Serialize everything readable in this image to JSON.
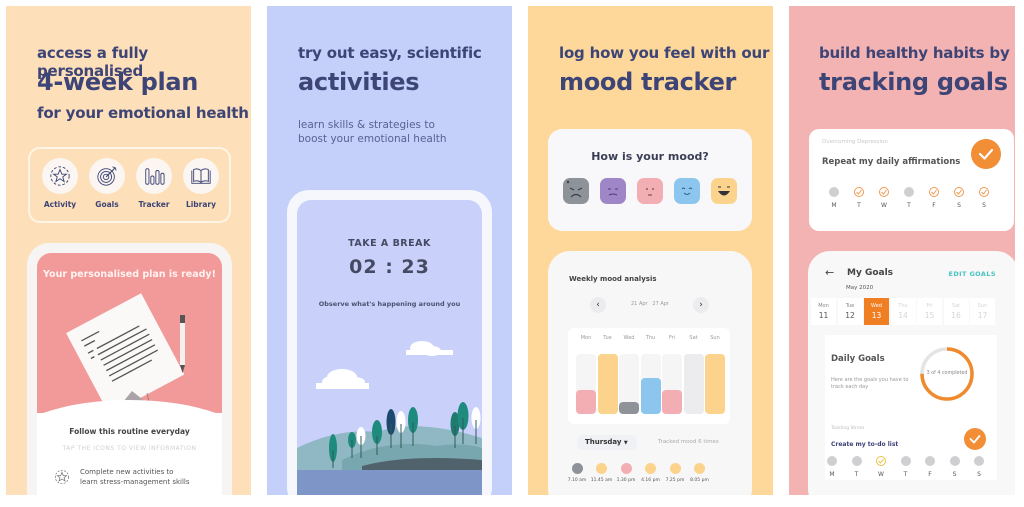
{
  "panels": [
    {
      "id": "plan",
      "background": "#fddfb9",
      "headline_small": "access a fully personalised",
      "headline_large": "4-week plan",
      "headline_small_2": "for your emotional health",
      "features": [
        {
          "label": "Activity",
          "icon": "star-badge-icon"
        },
        {
          "label": "Goals",
          "icon": "target-icon"
        },
        {
          "label": "Tracker",
          "icon": "bar-chart-icon"
        },
        {
          "label": "Library",
          "icon": "book-icon"
        }
      ],
      "phone": {
        "hero_title": "Your personalised plan is ready!",
        "routine_title": "Follow this routine everyday",
        "tap_hint": "TAP THE ICONS TO VIEW INFORMATION",
        "activity_line_1": "Complete new activities to",
        "activity_line_2": "learn stress-management skills"
      }
    },
    {
      "id": "activities",
      "background": "#c4cffa",
      "headline_small": "try out easy, scientific",
      "headline_large": "activities",
      "subtitle_1": "learn skills & strategies to",
      "subtitle_2": "boost your emotional health",
      "phone": {
        "title": "TAKE A BREAK",
        "timer": "02 : 23",
        "hint": "Observe what's happening around you"
      }
    },
    {
      "id": "mood",
      "background": "#fdd89a",
      "headline_small": "log how you feel with our",
      "headline_large": "mood tracker",
      "mood_card": {
        "question": "How is your mood?",
        "faces": [
          {
            "name": "angry",
            "color": "#8e9299"
          },
          {
            "name": "sad",
            "color": "#9f86c6"
          },
          {
            "name": "neutral",
            "color": "#f3aeb4"
          },
          {
            "name": "content",
            "color": "#8cc6ef"
          },
          {
            "name": "happy",
            "color": "#fbd38c"
          }
        ]
      },
      "phone": {
        "title": "Weekly mood analysis",
        "prev": "‹",
        "next": "›",
        "week_start": "21 Apr",
        "week_end": "27 Apr",
        "selected_day": "Thursday",
        "tracked_text": "Tracked mood 6 times",
        "entries": [
          {
            "time": "7.10 am",
            "color": "#8e9299"
          },
          {
            "time": "11.45 am",
            "color": "#fbd38c"
          },
          {
            "time": "1.30 pm",
            "color": "#f3aeb4"
          },
          {
            "time": "4.16 pm",
            "color": "#fbd38c"
          },
          {
            "time": "7.25 pm",
            "color": "#fbd38c"
          },
          {
            "time": "8.05 pm",
            "color": "#fbd38c"
          }
        ]
      }
    },
    {
      "id": "goals",
      "background": "#f4b3b3",
      "headline_small": "build healthy habits by",
      "headline_large": "tracking goals",
      "goal_card": {
        "category": "Overcoming Depression",
        "name": "Repeat my daily affirmations",
        "days": [
          {
            "label": "M",
            "done": false
          },
          {
            "label": "T",
            "done": true
          },
          {
            "label": "W",
            "done": true
          },
          {
            "label": "T",
            "done": false
          },
          {
            "label": "F",
            "done": true
          },
          {
            "label": "S",
            "done": true
          },
          {
            "label": "S",
            "done": true
          }
        ]
      },
      "phone": {
        "title": "My Goals",
        "back": "←",
        "edit_label": "EDIT GOALS",
        "month": "May 2020",
        "dates": [
          {
            "day": "Mon",
            "date": "11",
            "state": "past"
          },
          {
            "day": "Tue",
            "date": "12",
            "state": "past"
          },
          {
            "day": "Wed",
            "date": "13",
            "state": "active"
          },
          {
            "day": "Thu",
            "date": "14",
            "state": "future"
          },
          {
            "day": "Fri",
            "date": "15",
            "state": "future"
          },
          {
            "day": "Sat",
            "date": "16",
            "state": "future"
          },
          {
            "day": "Sun",
            "date": "17",
            "state": "future"
          }
        ],
        "daily_title": "Daily Goals",
        "daily_desc": "Here are the goals you have to track each day",
        "progress_text": "3 of 4 completed",
        "progress_completed": 3,
        "progress_total": 4,
        "goal2_category": "Tackling Stress",
        "goal2_name": "Create my to-do list",
        "goal2_days": [
          {
            "label": "M",
            "state": "off"
          },
          {
            "label": "T",
            "state": "off"
          },
          {
            "label": "W",
            "state": "today"
          },
          {
            "label": "T",
            "state": "off"
          },
          {
            "label": "F",
            "state": "off"
          },
          {
            "label": "S",
            "state": "off"
          },
          {
            "label": "S",
            "state": "off"
          }
        ]
      }
    }
  ],
  "chart_data": {
    "type": "bar",
    "title": "Weekly mood analysis",
    "categories": [
      "Mon",
      "Tue",
      "Wed",
      "Thu",
      "Fri",
      "Sat",
      "Sun"
    ],
    "values": [
      2,
      5,
      1,
      3,
      2,
      5,
      5
    ],
    "colors": [
      "#f3aeb4",
      "#fbd38c",
      "#8e9299",
      "#8cc6ef",
      "#f3aeb4",
      "#ececee",
      "#fbd38c"
    ],
    "ylim": [
      0,
      5
    ],
    "xlabel": "",
    "ylabel": ""
  }
}
